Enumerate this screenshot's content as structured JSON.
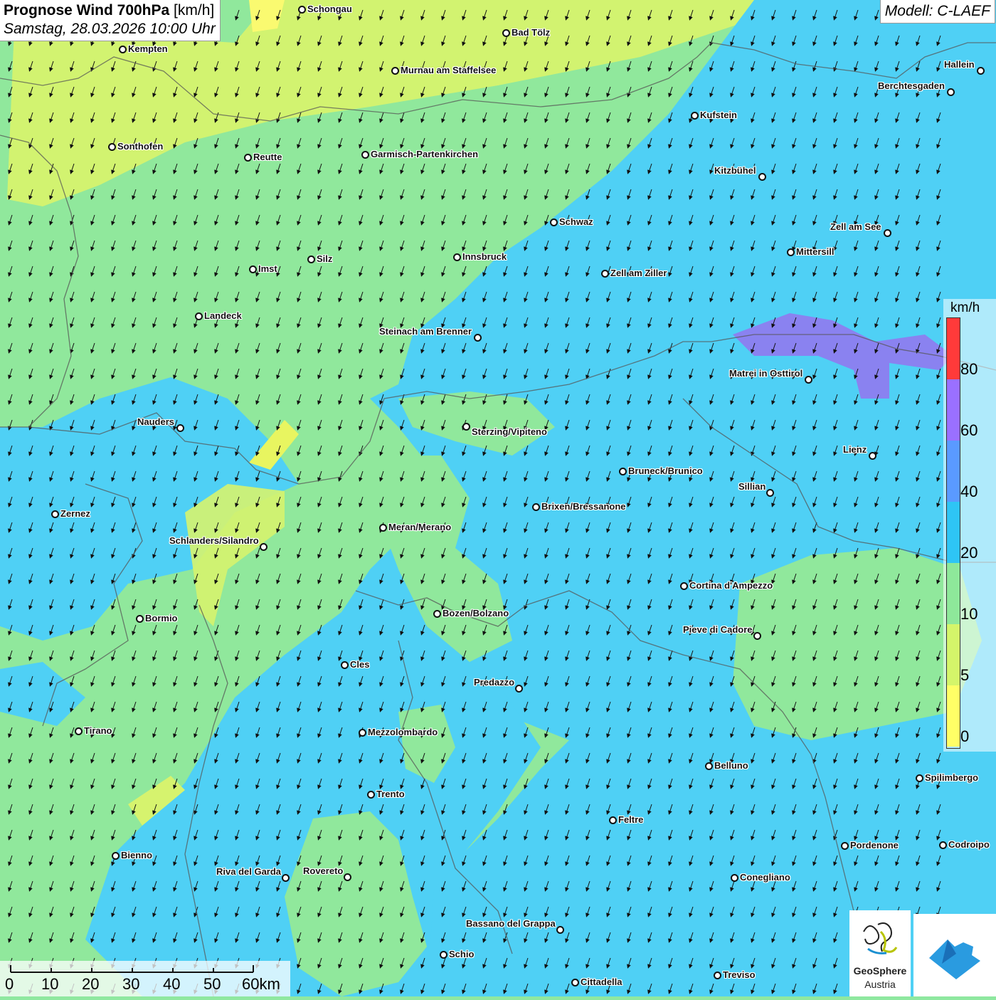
{
  "header": {
    "title_bold": "Prognose Wind 700hPa",
    "title_unit": "[km/h]",
    "datetime": "Samstag, 28.03.2026 10:00 Uhr",
    "model": "Modell: C-LAEF"
  },
  "legend": {
    "unit": "km/h",
    "ticks": [
      "80",
      "60",
      "40",
      "20",
      "10",
      "5",
      "0"
    ],
    "colors": [
      "#ff3a3a",
      "#9a70ff",
      "#5a9aff",
      "#2ec5f5",
      "#8ee89a",
      "#d4f56a",
      "#ffff66"
    ]
  },
  "scale_bar": {
    "labels": [
      "0",
      "10",
      "20",
      "30",
      "40",
      "50",
      "60km"
    ]
  },
  "logos": {
    "geosphere_line1": "GeoSphere",
    "geosphere_line2": "Austria"
  },
  "cities": [
    {
      "name": "Schongau",
      "id": "schongau"
    },
    {
      "name": "Bad Tölz",
      "id": "bad-toelz"
    },
    {
      "name": "Kempten",
      "id": "kempten"
    },
    {
      "name": "Murnau am Staffelsee",
      "id": "murnau"
    },
    {
      "name": "Hallein",
      "id": "hallein"
    },
    {
      "name": "Berchtesgaden",
      "id": "berchtesgaden"
    },
    {
      "name": "Kufstein",
      "id": "kufstein"
    },
    {
      "name": "Sonthofen",
      "id": "sonthofen"
    },
    {
      "name": "Reutte",
      "id": "reutte"
    },
    {
      "name": "Garmisch-Partenkirchen",
      "id": "garmisch"
    },
    {
      "name": "Kitzbühel",
      "id": "kitzbuehel"
    },
    {
      "name": "Schwaz",
      "id": "schwaz"
    },
    {
      "name": "Zell am See",
      "id": "zell-am-see"
    },
    {
      "name": "Innsbruck",
      "id": "innsbruck"
    },
    {
      "name": "Mittersill",
      "id": "mittersill"
    },
    {
      "name": "Silz",
      "id": "silz"
    },
    {
      "name": "Imst",
      "id": "imst"
    },
    {
      "name": "Zell am Ziller",
      "id": "zell-am-ziller"
    },
    {
      "name": "Landeck",
      "id": "landeck"
    },
    {
      "name": "Steinach am Brenner",
      "id": "steinach"
    },
    {
      "name": "Matrei in Osttirol",
      "id": "matrei"
    },
    {
      "name": "Nauders",
      "id": "nauders"
    },
    {
      "name": "Sterzing/Vipiteno",
      "id": "sterzing"
    },
    {
      "name": "Lienz",
      "id": "lienz"
    },
    {
      "name": "Bruneck/Brunico",
      "id": "bruneck"
    },
    {
      "name": "Sillian",
      "id": "sillian"
    },
    {
      "name": "Zernez",
      "id": "zernez"
    },
    {
      "name": "Brixen/Bressanone",
      "id": "brixen"
    },
    {
      "name": "Meran/Merano",
      "id": "meran"
    },
    {
      "name": "Schlanders/Silandro",
      "id": "schlanders"
    },
    {
      "name": "Cortina d'Ampezzo",
      "id": "cortina"
    },
    {
      "name": "Bozen/Bolzano",
      "id": "bozen"
    },
    {
      "name": "Bormio",
      "id": "bormio"
    },
    {
      "name": "Pieve di Cadore",
      "id": "pieve"
    },
    {
      "name": "Cles",
      "id": "cles"
    },
    {
      "name": "Predazzo",
      "id": "predazzo"
    },
    {
      "name": "Tirano",
      "id": "tirano"
    },
    {
      "name": "Mezzolombardo",
      "id": "mezzolombardo"
    },
    {
      "name": "Belluno",
      "id": "belluno"
    },
    {
      "name": "Spilimbergo",
      "id": "spilimbergo"
    },
    {
      "name": "Trento",
      "id": "trento"
    },
    {
      "name": "Feltre",
      "id": "feltre"
    },
    {
      "name": "Pordenone",
      "id": "pordenone"
    },
    {
      "name": "Codroipo",
      "id": "codroipo"
    },
    {
      "name": "Bienno",
      "id": "bienno"
    },
    {
      "name": "Riva del Garda",
      "id": "riva"
    },
    {
      "name": "Rovereto",
      "id": "rovereto"
    },
    {
      "name": "Conegliano",
      "id": "conegliano"
    },
    {
      "name": "Bassano del Grappa",
      "id": "bassano"
    },
    {
      "name": "Schio",
      "id": "schio"
    },
    {
      "name": "Treviso",
      "id": "treviso"
    },
    {
      "name": "Cittadella",
      "id": "cittadella"
    }
  ]
}
